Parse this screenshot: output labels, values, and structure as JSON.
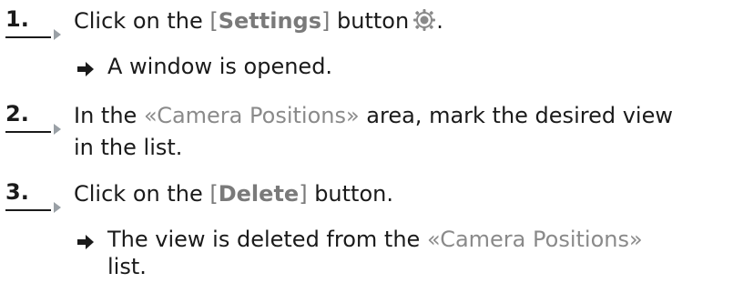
{
  "steps": [
    {
      "number": "1.",
      "parts": {
        "pre": "Click on the ",
        "btn_open": "[",
        "btn_label": "Settings",
        "btn_close": "]",
        "post": " button",
        "end": "."
      },
      "icon": "settings-gear-icon",
      "result": "A window is opened."
    },
    {
      "number": "2.",
      "parts": {
        "pre": "In the ",
        "area": "«Camera Positions»",
        "post": " area, mark the desired view",
        "line2": "in the list."
      }
    },
    {
      "number": "3.",
      "parts": {
        "pre": "Click on the ",
        "btn_open": "[",
        "btn_label": "Delete",
        "btn_close": "]",
        "post": " button."
      },
      "result": {
        "pre": "The view is deleted from the ",
        "area": "«Camera Positions»",
        "line2": "list."
      }
    }
  ],
  "colors": {
    "text": "#1a1a1a",
    "reference": "#7a7a7a",
    "marker": "#9aa0a6"
  }
}
